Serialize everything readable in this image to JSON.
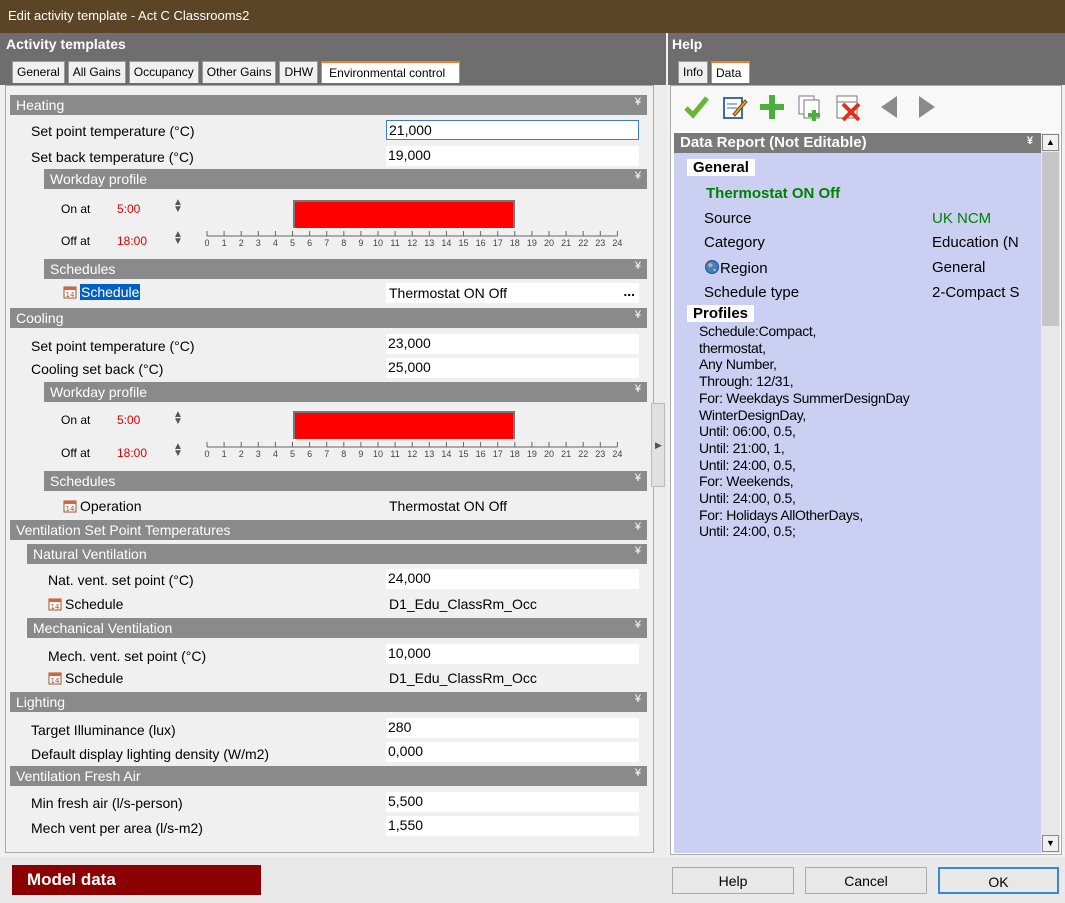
{
  "window": {
    "title": "Edit activity template - Act C Classrooms2"
  },
  "left": {
    "title": "Activity templates",
    "tabs": [
      "General",
      "All Gains",
      "Occupancy",
      "Other Gains",
      "DHW",
      "Environmental control"
    ],
    "active_tab": "Environmental control",
    "heating": {
      "title": "Heating",
      "set_point_label": "Set point temperature (°C)",
      "set_point_value": "21,000",
      "set_back_label": "Set back temperature (°C)",
      "set_back_value": "19,000",
      "workday_title": "Workday profile",
      "on_label": "On at",
      "on_time": "5:00",
      "off_label": "Off at",
      "off_time": "18:00",
      "on_hour": 5,
      "off_hour": 18,
      "schedules_title": "Schedules",
      "schedule_label": "Schedule",
      "schedule_value": "Thermostat ON Off",
      "browse": "..."
    },
    "cooling": {
      "title": "Cooling",
      "set_point_label": "Set point temperature (°C)",
      "set_point_value": "23,000",
      "set_back_label": "Cooling set back (°C)",
      "set_back_value": "25,000",
      "workday_title": "Workday profile",
      "on_label": "On at",
      "on_time": "5:00",
      "off_label": "Off at",
      "off_time": "18:00",
      "on_hour": 5,
      "off_hour": 18,
      "schedules_title": "Schedules",
      "operation_label": "Operation",
      "operation_value": "Thermostat ON Off"
    },
    "ventilation_sp": {
      "title": "Ventilation Set Point Temperatures",
      "natural_title": "Natural Ventilation",
      "nat_label": "Nat. vent. set point (°C)",
      "nat_value": "24,000",
      "nat_schedule_label": "Schedule",
      "nat_schedule_value": "D1_Edu_ClassRm_Occ",
      "mech_title": "Mechanical Ventilation",
      "mech_label": "Mech. vent. set point (°C)",
      "mech_value": "10,000",
      "mech_schedule_label": "Schedule",
      "mech_schedule_value": "D1_Edu_ClassRm_Occ"
    },
    "lighting": {
      "title": "Lighting",
      "illum_label": "Target Illuminance (lux)",
      "illum_value": "280",
      "density_label": "Default display lighting density (W/m2)",
      "density_value": "0,000"
    },
    "fresh_air": {
      "title": "Ventilation Fresh Air",
      "min_label": "Min fresh air (l/s-person)",
      "min_value": "5,500",
      "area_label": "Mech vent per area (l/s-m2)",
      "area_value": "1,550"
    },
    "ruler_ticks": [
      "0",
      "1",
      "2",
      "3",
      "4",
      "5",
      "6",
      "7",
      "8",
      "9",
      "10",
      "11",
      "12",
      "13",
      "14",
      "15",
      "16",
      "17",
      "18",
      "19",
      "20",
      "21",
      "22",
      "23",
      "24"
    ]
  },
  "right": {
    "title": "Help",
    "tabs": [
      "Info",
      "Data"
    ],
    "active_tab": "Data",
    "toolbar_icons": [
      "check-icon",
      "edit-icon",
      "add-icon",
      "copy-add-icon",
      "delete-icon",
      "prev-icon",
      "next-icon"
    ],
    "report": {
      "title": "Data Report (Not Editable)",
      "general_head": "General",
      "name": "Thermostat ON Off",
      "rows": [
        {
          "label": "Source",
          "value": "UK NCM"
        },
        {
          "label": "Category",
          "value": "Education (N"
        },
        {
          "label": "Region",
          "value": "General"
        },
        {
          "label": "Schedule type",
          "value": "2-Compact S"
        }
      ],
      "profiles_head": "Profiles",
      "profile_lines": [
        "Schedule:Compact,",
        "thermostat,",
        "Any Number,",
        "Through: 12/31,",
        "For: Weekdays SummerDesignDay",
        "WinterDesignDay,",
        "Until: 06:00, 0.5,",
        "Until: 21:00, 1,",
        "Until: 24:00, 0.5,",
        "For: Weekends,",
        "Until: 24:00, 0.5,",
        "For: Holidays AllOtherDays,",
        "Until: 24:00, 0.5;"
      ]
    }
  },
  "footer": {
    "model_data": "Model data",
    "help": "Help",
    "cancel": "Cancel",
    "ok": "OK"
  },
  "colors": {
    "title_bar": "#5b4526",
    "profile_bar": "#ff0000",
    "model_button": "#8b0000",
    "source_green": "#008000",
    "report_bg": "#cbd0f2"
  }
}
